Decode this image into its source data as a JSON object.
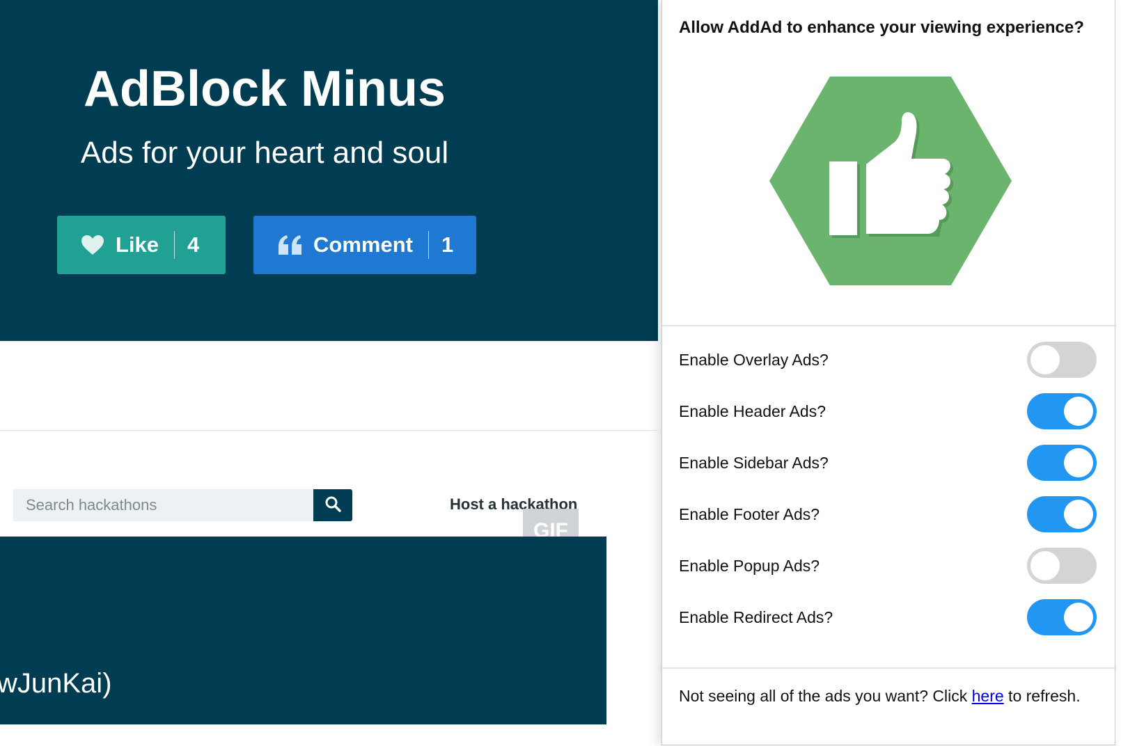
{
  "hero": {
    "title": "AdBlock Minus",
    "subtitle": "Ads for your heart and soul",
    "like_label": "Like",
    "like_count": "4",
    "comment_label": "Comment",
    "comment_count": "1"
  },
  "nav": {
    "search_placeholder": "Search hackathons",
    "host_link": "Host a hackathon",
    "gif_badge": "GIF"
  },
  "banner": {
    "text": "wJunKai)"
  },
  "popup": {
    "heading": "Allow AddAd to enhance your viewing experience?",
    "toggles": [
      {
        "label": "Enable Overlay Ads?",
        "enabled": false
      },
      {
        "label": "Enable Header Ads?",
        "enabled": true
      },
      {
        "label": "Enable Sidebar Ads?",
        "enabled": true
      },
      {
        "label": "Enable Footer Ads?",
        "enabled": true
      },
      {
        "label": "Enable Popup Ads?",
        "enabled": false
      },
      {
        "label": "Enable Redirect Ads?",
        "enabled": true
      }
    ],
    "footer_prefix": "Not seeing all of the ads you want? Click ",
    "footer_link": "here",
    "footer_suffix": " to refresh."
  },
  "colors": {
    "hero_bg": "#003d52",
    "like_button": "#21a193",
    "comment_button": "#1f78d1",
    "toggle_on": "#2196f3",
    "toggle_off": "#d4d4d4",
    "logo_green": "#6bb46e"
  },
  "icons": {
    "like": "heart-icon",
    "comment": "quote-icon",
    "search": "search-icon",
    "logo": "thumbs-up-icon"
  }
}
